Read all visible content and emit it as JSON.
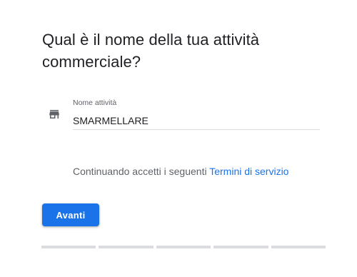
{
  "header": {
    "title": "Qual è il nome della tua attività commerciale?"
  },
  "business_name_field": {
    "icon": "store-icon",
    "label": "Nome attività",
    "value": "SMARMELLARE"
  },
  "terms": {
    "text": "Continuando accetti i seguenti ",
    "link_text": "Termini di servizio"
  },
  "next_button": {
    "label": "Avanti"
  },
  "progress": {
    "total_steps": 5,
    "completed_steps": 0
  },
  "colors": {
    "accent": "#1a73e8",
    "text_primary": "#202124",
    "text_secondary": "#5f6368",
    "divider": "#dadce0"
  }
}
